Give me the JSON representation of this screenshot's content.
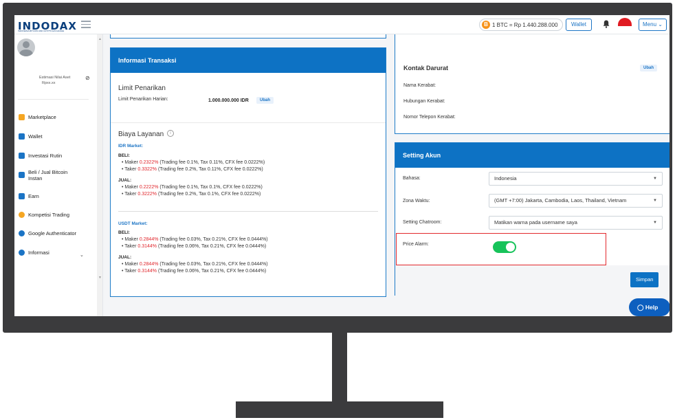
{
  "header": {
    "logo": "INDODAX",
    "logo_sub": "INDONESIA BITCOIN AND CRYPTO EXCHANGE",
    "btc_coin": "B",
    "btc_rate": "1 BTC = Rp 1.440.288.000",
    "wallet_label": "Wallet",
    "menu_label": "Menu"
  },
  "sidebar": {
    "asset_label": "Estimasi Nilai Aset",
    "asset_value": "Rpxx.xx",
    "items": [
      {
        "label": "Marketplace",
        "icon": "chart-bars-icon",
        "color": "#f5a623"
      },
      {
        "label": "Wallet",
        "icon": "wallet-icon",
        "color": "#1b74c5"
      },
      {
        "label": "Investasi Rutin",
        "icon": "calendar-icon",
        "color": "#1b74c5"
      },
      {
        "label": "Beli / Jual Bitcoin Instan",
        "icon": "swap-arrows-icon",
        "color": "#1b74c5"
      },
      {
        "label": "Earn",
        "icon": "earn-icon",
        "color": "#1b74c5"
      },
      {
        "label": "Kompetisi Trading",
        "icon": "trophy-icon",
        "color": "#f5a623"
      },
      {
        "label": "Google Authenticator",
        "icon": "google-auth-icon",
        "color": "#1b74c5"
      },
      {
        "label": "Informasi",
        "icon": "info-icon",
        "color": "#1b74c5"
      }
    ]
  },
  "transaksi": {
    "title": "Informasi Transaksi",
    "limit_title": "Limit Penarikan",
    "limit_label": "Limit Penarikan Harian:",
    "limit_value": "1.000.000.000",
    "limit_unit": "IDR",
    "ubah": "Ubah",
    "biaya_title": "Biaya Layanan",
    "idr_market": "IDR Market:",
    "usdt_market": "USDT Market:",
    "beli": "BELI:",
    "jual": "JUAL:",
    "idr_beli_maker_label": "Maker",
    "idr_beli_maker_rate": "0.2322%",
    "idr_beli_maker_detail": "(Trading fee 0.1%, Tax 0.11%, CFX fee 0.0222%)",
    "idr_beli_taker_label": "Taker",
    "idr_beli_taker_rate": "0.3322%",
    "idr_beli_taker_detail": "(Trading fee 0.2%, Tax 0.11%, CFX fee 0.0222%)",
    "idr_jual_maker_label": "Maker",
    "idr_jual_maker_rate": "0.2222%",
    "idr_jual_maker_detail": "(Trading fee 0.1%, Tax 0.1%, CFX fee 0.0222%)",
    "idr_jual_taker_label": "Taker",
    "idr_jual_taker_rate": "0.3222%",
    "idr_jual_taker_detail": "(Trading fee 0.2%, Tax 0.1%, CFX fee 0.0222%)",
    "usdt_beli_maker_label": "Maker",
    "usdt_beli_maker_rate": "0.2844%",
    "usdt_beli_maker_detail": "(Trading fee 0.03%, Tax 0.21%, CFX fee 0.0444%)",
    "usdt_beli_taker_label": "Taker",
    "usdt_beli_taker_rate": "0.3144%",
    "usdt_beli_taker_detail": "(Trading fee 0.06%, Tax 0.21%, CFX fee 0.0444%)",
    "usdt_jual_maker_label": "Maker",
    "usdt_jual_maker_rate": "0.2844%",
    "usdt_jual_maker_detail": "(Trading fee 0.03%, Tax 0.21%, CFX fee 0.0444%)",
    "usdt_jual_taker_label": "Taker",
    "usdt_jual_taker_rate": "0.3144%",
    "usdt_jual_taker_detail": "(Trading fee 0.06%, Tax 0.21%, CFX fee 0.0444%)"
  },
  "kontak": {
    "title": "Kontak Darurat",
    "ubah": "Ubah",
    "nama": "Nama Kerabat:",
    "hubungan": "Hubungan Kerabat:",
    "telepon": "Nomor Telepon Kerabat:"
  },
  "setting": {
    "title": "Setting Akun",
    "bahasa_label": "Bahasa:",
    "bahasa_value": "Indonesia",
    "zona_label": "Zona Waktu:",
    "zona_value": "(GMT +7:00) Jakarta, Cambodia, Laos, Thailand, Vietnam",
    "chat_label": "Setting Chatroom:",
    "chat_value": "Matikan warna pada username saya",
    "alarm_label": "Price Alarm:",
    "alarm_on": true,
    "simpan": "Simpan"
  },
  "help_label": "Help",
  "colors": {
    "accent": "#0d72c4",
    "toggle_on": "#17c35a",
    "highlight": "#e2272b",
    "fee_red": "#e0252b"
  }
}
